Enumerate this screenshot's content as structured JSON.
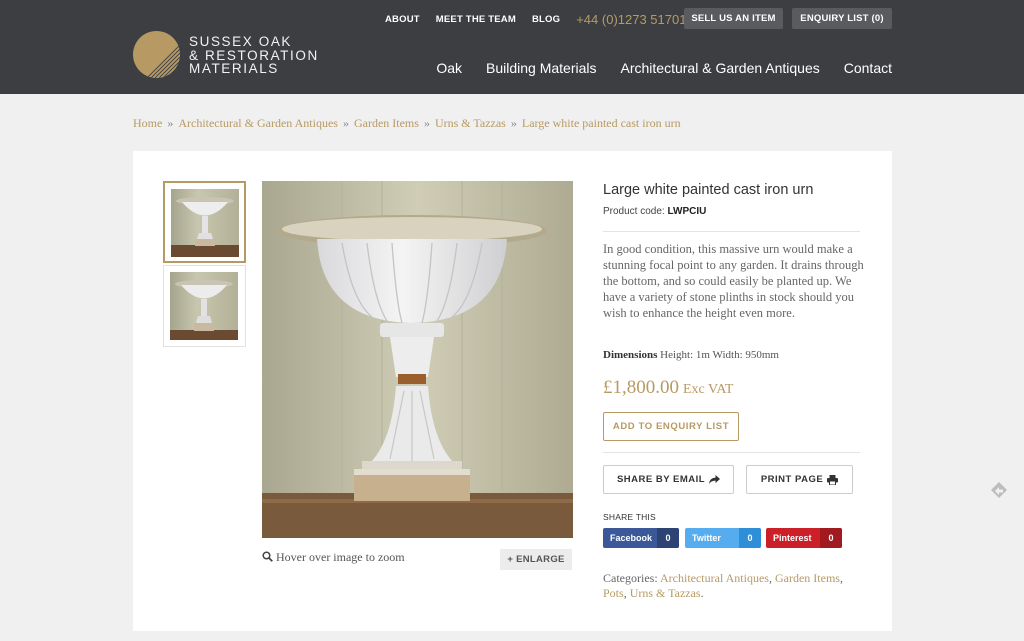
{
  "header": {
    "logo_lines": [
      "SUSSEX OAK",
      "& RESTORATION",
      "MATERIALS"
    ],
    "top_links": [
      "ABOUT",
      "MEET THE TEAM",
      "BLOG"
    ],
    "phone": "+44 (0)1273 517013",
    "sell_button": "SELL US AN ITEM",
    "enquiry_button": "ENQUIRY LIST (0)",
    "main_nav": [
      "Oak",
      "Building Materials",
      "Architectural & Garden Antiques",
      "Contact"
    ]
  },
  "breadcrumb": [
    "Home",
    "Architectural & Garden Antiques",
    "Garden Items",
    "Urns & Tazzas",
    "Large white painted cast iron urn"
  ],
  "product": {
    "title": "Large white painted cast iron urn",
    "code_label": "Product code:",
    "code": "LWPCIU",
    "description": "In good condition, this massive urn would make a stunning focal point to any garden. It drains through the bottom, and so could easily be planted up. We have a variety of stone plinths in stock should you wish to enhance the height even more.",
    "dimensions_label": "Dimensions",
    "dimensions": "Height: 1m Width: 950mm",
    "price": "£1,800.00",
    "price_suffix": "Exc VAT",
    "add_button": "ADD TO ENQUIRY LIST",
    "share_email": "SHARE BY EMAIL",
    "print_page": "PRINT PAGE",
    "share_this": "SHARE THIS",
    "zoom_hint": "Hover over image to zoom",
    "enlarge": "+ ENLARGE"
  },
  "share": [
    {
      "name": "Facebook",
      "count": "0",
      "color": "#3b5998"
    },
    {
      "name": "Twitter",
      "count": "0",
      "color": "#55acee"
    },
    {
      "name": "Pinterest",
      "count": "0",
      "color": "#cb2027"
    }
  ],
  "categories": {
    "label": "Categories:",
    "items": [
      "Architectural Antiques",
      "Garden Items",
      "Pots",
      "Urns & Tazzas"
    ]
  },
  "colors": {
    "accent": "#b79a63",
    "header_bg": "#3d3e42"
  }
}
